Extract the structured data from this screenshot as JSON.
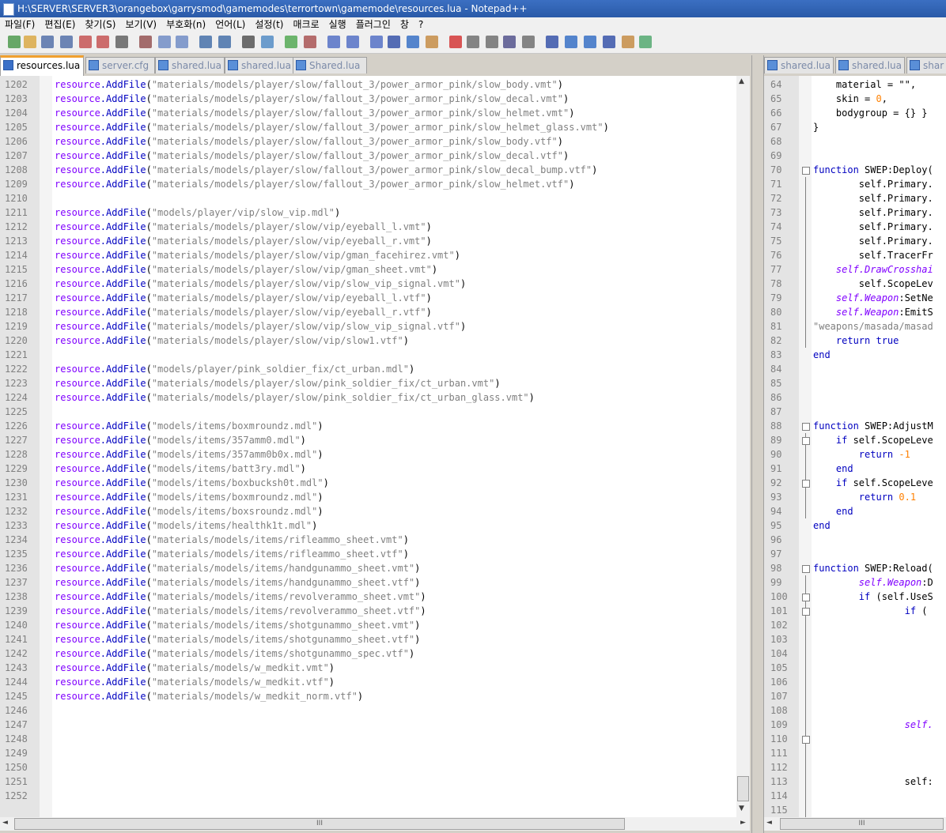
{
  "window": {
    "title": "H:\\SERVER\\SERVER3\\orangebox\\garrysmod\\gamemodes\\terrortown\\gamemode\\resources.lua - Notepad++"
  },
  "menu": [
    "파일(F)",
    "편집(E)",
    "찾기(S)",
    "보기(V)",
    "부호화(n)",
    "언어(L)",
    "설정(t)",
    "매크로",
    "실행",
    "플러그인",
    "창",
    "?"
  ],
  "tabs_left": [
    {
      "label": "resources.lua",
      "active": true
    },
    {
      "label": "server.cfg",
      "active": false
    },
    {
      "label": "shared.lua",
      "active": false
    },
    {
      "label": "shared.lua",
      "active": false
    },
    {
      "label": "Shared.lua",
      "active": false
    }
  ],
  "tabs_right": [
    {
      "label": "shared.lua"
    },
    {
      "label": "shared.lua"
    },
    {
      "label": "shar"
    }
  ],
  "colors": {
    "keyword": "#8000ff",
    "method": "#0000c0",
    "string": "#808080",
    "lua_keyword": "#0000c0",
    "number": "#ff8000",
    "active_tab_accent": "#f0a030"
  },
  "left_editor": {
    "lines": [
      {
        "n": "1202",
        "s": "\"materials/models/player/slow/fallout_3/power_armor_pink/slow_body.vmt\""
      },
      {
        "n": "1203",
        "s": "\"materials/models/player/slow/fallout_3/power_armor_pink/slow_decal.vmt\""
      },
      {
        "n": "1204",
        "s": "\"materials/models/player/slow/fallout_3/power_armor_pink/slow_helmet.vmt\""
      },
      {
        "n": "1205",
        "s": "\"materials/models/player/slow/fallout_3/power_armor_pink/slow_helmet_glass.vmt\""
      },
      {
        "n": "1206",
        "s": "\"materials/models/player/slow/fallout_3/power_armor_pink/slow_body.vtf\""
      },
      {
        "n": "1207",
        "s": "\"materials/models/player/slow/fallout_3/power_armor_pink/slow_decal.vtf\""
      },
      {
        "n": "1208",
        "s": "\"materials/models/player/slow/fallout_3/power_armor_pink/slow_decal_bump.vtf\""
      },
      {
        "n": "1209",
        "s": "\"materials/models/player/slow/fallout_3/power_armor_pink/slow_helmet.vtf\""
      },
      {
        "n": "1210",
        "s": ""
      },
      {
        "n": "1211",
        "s": "\"models/player/vip/slow_vip.mdl\""
      },
      {
        "n": "1212",
        "s": "\"materials/models/player/slow/vip/eyeball_l.vmt\""
      },
      {
        "n": "1213",
        "s": "\"materials/models/player/slow/vip/eyeball_r.vmt\""
      },
      {
        "n": "1214",
        "s": "\"materials/models/player/slow/vip/gman_facehirez.vmt\""
      },
      {
        "n": "1215",
        "s": "\"materials/models/player/slow/vip/gman_sheet.vmt\""
      },
      {
        "n": "1216",
        "s": "\"materials/models/player/slow/vip/slow_vip_signal.vmt\""
      },
      {
        "n": "1217",
        "s": "\"materials/models/player/slow/vip/eyeball_l.vtf\""
      },
      {
        "n": "1218",
        "s": "\"materials/models/player/slow/vip/eyeball_r.vtf\""
      },
      {
        "n": "1219",
        "s": "\"materials/models/player/slow/vip/slow_vip_signal.vtf\""
      },
      {
        "n": "1220",
        "s": "\"materials/models/player/slow/vip/slow1.vtf\""
      },
      {
        "n": "1221",
        "s": ""
      },
      {
        "n": "1222",
        "s": "\"models/player/pink_soldier_fix/ct_urban.mdl\""
      },
      {
        "n": "1223",
        "s": "\"materials/models/player/slow/pink_soldier_fix/ct_urban.vmt\""
      },
      {
        "n": "1224",
        "s": "\"materials/models/player/slow/pink_soldier_fix/ct_urban_glass.vmt\""
      },
      {
        "n": "1225",
        "s": ""
      },
      {
        "n": "1226",
        "s": "\"models/items/boxmroundz.mdl\""
      },
      {
        "n": "1227",
        "s": "\"models/items/357amm0.mdl\""
      },
      {
        "n": "1228",
        "s": "\"models/items/357amm0b0x.mdl\""
      },
      {
        "n": "1229",
        "s": "\"models/items/batt3ry.mdl\""
      },
      {
        "n": "1230",
        "s": "\"models/items/boxbucksh0t.mdl\""
      },
      {
        "n": "1231",
        "s": "\"models/items/boxmroundz.mdl\""
      },
      {
        "n": "1232",
        "s": "\"models/items/boxsroundz.mdl\""
      },
      {
        "n": "1233",
        "s": "\"models/items/healthk1t.mdl\""
      },
      {
        "n": "1234",
        "s": "\"materials/models/items/rifleammo_sheet.vmt\""
      },
      {
        "n": "1235",
        "s": "\"materials/models/items/rifleammo_sheet.vtf\""
      },
      {
        "n": "1236",
        "s": "\"materials/models/items/handgunammo_sheet.vmt\""
      },
      {
        "n": "1237",
        "s": "\"materials/models/items/handgunammo_sheet.vtf\""
      },
      {
        "n": "1238",
        "s": "\"materials/models/items/revolverammo_sheet.vmt\""
      },
      {
        "n": "1239",
        "s": "\"materials/models/items/revolverammo_sheet.vtf\""
      },
      {
        "n": "1240",
        "s": "\"materials/models/items/shotgunammo_sheet.vmt\""
      },
      {
        "n": "1241",
        "s": "\"materials/models/items/shotgunammo_sheet.vtf\""
      },
      {
        "n": "1242",
        "s": "\"materials/models/items/shotgunammo_spec.vtf\""
      },
      {
        "n": "1243",
        "s": "\"materials/models/w_medkit.vmt\""
      },
      {
        "n": "1244",
        "s": "\"materials/models/w_medkit.vtf\""
      },
      {
        "n": "1245",
        "s": "\"materials/models/w_medkit_norm.vtf\""
      },
      {
        "n": "1246",
        "s": ""
      },
      {
        "n": "1247",
        "s": ""
      },
      {
        "n": "1248",
        "s": ""
      },
      {
        "n": "1249",
        "s": ""
      },
      {
        "n": "1250",
        "s": ""
      },
      {
        "n": "1251",
        "s": ""
      },
      {
        "n": "1252",
        "s": ""
      }
    ],
    "prefix_obj": "resource",
    "prefix_method": ".AddFile",
    "paren_open": "(",
    "paren_close": ")"
  },
  "right_editor": {
    "lines": [
      {
        "n": "64",
        "t": [
          [
            "pn",
            "    material = \"\","
          ]
        ]
      },
      {
        "n": "65",
        "t": [
          [
            "pn",
            "    skin = "
          ],
          [
            "lnum",
            "0"
          ],
          [
            "pn",
            ","
          ]
        ]
      },
      {
        "n": "66",
        "t": [
          [
            "pn",
            "    bodygroup = {} }"
          ]
        ]
      },
      {
        "n": "67",
        "t": [
          [
            "pn",
            "}"
          ]
        ]
      },
      {
        "n": "68",
        "t": []
      },
      {
        "n": "69",
        "t": []
      },
      {
        "n": "70",
        "t": [
          [
            "lkw",
            "function"
          ],
          [
            "pn",
            " SWEP:Deploy("
          ]
        ]
      },
      {
        "n": "71",
        "t": [
          [
            "pn",
            "        self.Primary."
          ]
        ]
      },
      {
        "n": "72",
        "t": [
          [
            "pn",
            "        self.Primary."
          ]
        ]
      },
      {
        "n": "73",
        "t": [
          [
            "pn",
            "        self.Primary."
          ]
        ]
      },
      {
        "n": "74",
        "t": [
          [
            "pn",
            "        self.Primary."
          ]
        ]
      },
      {
        "n": "75",
        "t": [
          [
            "pn",
            "        self.Primary."
          ]
        ]
      },
      {
        "n": "76",
        "t": [
          [
            "pn",
            "        self.TracerFr"
          ]
        ]
      },
      {
        "n": "77",
        "t": [
          [
            "lit",
            "    self.DrawCrosshai"
          ]
        ]
      },
      {
        "n": "78",
        "t": [
          [
            "pn",
            "        self.ScopeLev"
          ]
        ]
      },
      {
        "n": "79",
        "t": [
          [
            "lit",
            "    self.Weapon"
          ],
          [
            "pn",
            ":SetNe"
          ]
        ]
      },
      {
        "n": "80",
        "t": [
          [
            "lit",
            "    self.Weapon"
          ],
          [
            "pn",
            ":EmitS"
          ]
        ]
      },
      {
        "n": "81",
        "t": [
          [
            "lstr",
            "\"weapons/masada/masad"
          ]
        ]
      },
      {
        "n": "82",
        "t": [
          [
            "lkw",
            "    return true"
          ]
        ]
      },
      {
        "n": "83",
        "t": [
          [
            "lkw",
            "end"
          ]
        ]
      },
      {
        "n": "84",
        "t": []
      },
      {
        "n": "85",
        "t": []
      },
      {
        "n": "86",
        "t": []
      },
      {
        "n": "87",
        "t": []
      },
      {
        "n": "88",
        "t": [
          [
            "lkw",
            "function"
          ],
          [
            "pn",
            " SWEP:AdjustM"
          ]
        ]
      },
      {
        "n": "89",
        "t": [
          [
            "lkw",
            "    if"
          ],
          [
            "pn",
            " self.ScopeLeve"
          ]
        ]
      },
      {
        "n": "90",
        "t": [
          [
            "lkw",
            "        return"
          ],
          [
            "pn",
            " "
          ],
          [
            "lnum",
            "-1"
          ]
        ]
      },
      {
        "n": "91",
        "t": [
          [
            "lkw",
            "    end"
          ]
        ]
      },
      {
        "n": "92",
        "t": [
          [
            "lkw",
            "    if"
          ],
          [
            "pn",
            " self.ScopeLeve"
          ]
        ]
      },
      {
        "n": "93",
        "t": [
          [
            "lkw",
            "        return"
          ],
          [
            "pn",
            " "
          ],
          [
            "lnum",
            "0.1"
          ]
        ]
      },
      {
        "n": "94",
        "t": [
          [
            "lkw",
            "    end"
          ]
        ]
      },
      {
        "n": "95",
        "t": [
          [
            "lkw",
            "end"
          ]
        ]
      },
      {
        "n": "96",
        "t": []
      },
      {
        "n": "97",
        "t": []
      },
      {
        "n": "98",
        "t": [
          [
            "lkw",
            "function"
          ],
          [
            "pn",
            " SWEP:Reload("
          ]
        ]
      },
      {
        "n": "99",
        "t": [
          [
            "lit",
            "        self.Weapon"
          ],
          [
            "pn",
            ":D"
          ]
        ]
      },
      {
        "n": "100",
        "t": [
          [
            "lkw",
            "        if"
          ],
          [
            "pn",
            " (self.UseS"
          ]
        ]
      },
      {
        "n": "101",
        "t": [
          [
            "lkw",
            "                if"
          ],
          [
            "pn",
            " ("
          ]
        ]
      },
      {
        "n": "102",
        "t": []
      },
      {
        "n": "103",
        "t": []
      },
      {
        "n": "104",
        "t": []
      },
      {
        "n": "105",
        "t": []
      },
      {
        "n": "106",
        "t": []
      },
      {
        "n": "107",
        "t": []
      },
      {
        "n": "108",
        "t": []
      },
      {
        "n": "109",
        "t": [
          [
            "lit",
            "                self."
          ]
        ]
      },
      {
        "n": "110",
        "t": []
      },
      {
        "n": "111",
        "t": []
      },
      {
        "n": "112",
        "t": []
      },
      {
        "n": "113",
        "t": [
          [
            "pn",
            "                self:"
          ]
        ]
      },
      {
        "n": "114",
        "t": []
      },
      {
        "n": "115",
        "t": []
      }
    ]
  },
  "scroll": {
    "h_grip": "III",
    "v_up": "▲",
    "v_down": "▼",
    "h_left": "◄",
    "h_right": "►"
  }
}
